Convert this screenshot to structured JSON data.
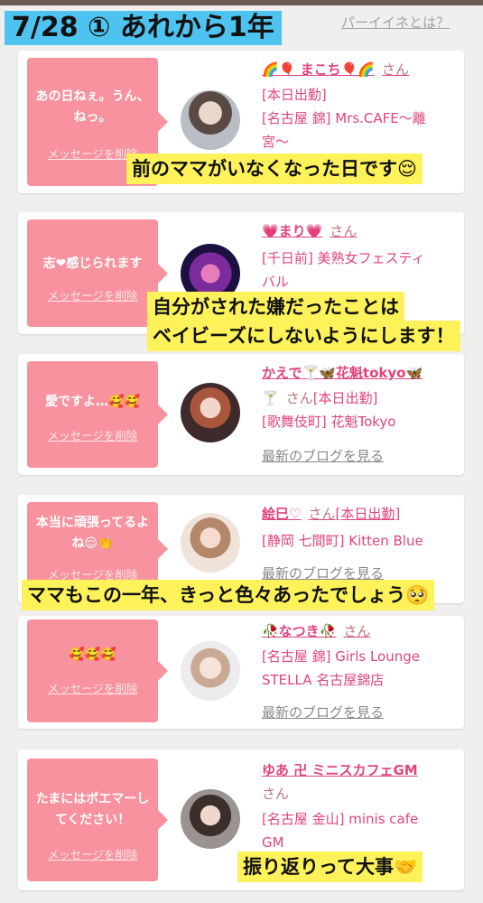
{
  "header": {
    "title": "7/28 ① あれから1年",
    "help_link": "パーイイネとは？"
  },
  "common": {
    "delete_label": "メッセージを削除",
    "san": "さん",
    "blog_label": "最新のブログを見る"
  },
  "cards": [
    {
      "message": "あの日ねぇ。うん、ねっ。",
      "name": "🌈🎈 まこち🎈🌈",
      "status": "",
      "shop_lines": [
        "[本日出勤]",
        "[名古屋 錦] Mrs.CAFE～離",
        "宮～"
      ]
    },
    {
      "message": "志❤感じられます",
      "name": "💗まり💗",
      "status": "",
      "shop_lines": [
        "[千日前] 美熟女フェスティ",
        "バル"
      ]
    },
    {
      "message": "愛ですよ…🥰🥰",
      "name": "かえで🍸🦋花魁tokyo🦋",
      "status": "[本日出勤]",
      "shop_lines": [
        "[歌舞伎町] 花魁Tokyo"
      ]
    },
    {
      "message": "本当に頑張ってるよね😌👏",
      "name": "絵巳♡",
      "status": "[本日出勤]",
      "shop_lines": [
        "[静岡 七間町] Kitten Blue"
      ]
    },
    {
      "message": "🥰🥰🥰",
      "name": "🥀なつき🥀",
      "status": "",
      "shop_lines": [
        "[名古屋 錦] Girls Lounge",
        "STELLA 名古屋錦店"
      ]
    },
    {
      "message": "たまにはポエマーしてください！",
      "name": "ゆあ 卍 ミニスカフェGM",
      "status": "",
      "shop_lines": [
        "[名古屋 金山] minis cafe",
        "GM"
      ]
    }
  ],
  "captions": {
    "c1": "前のママがいなくなった日です😌",
    "c2_line1": "自分がされた嫌だったことは",
    "c2_line2": "ベイビーズにしないようにします！",
    "c3": "ママもこの一年、きっと色々あったでしょう🥺",
    "c4": "振り返りって大事🤝"
  }
}
